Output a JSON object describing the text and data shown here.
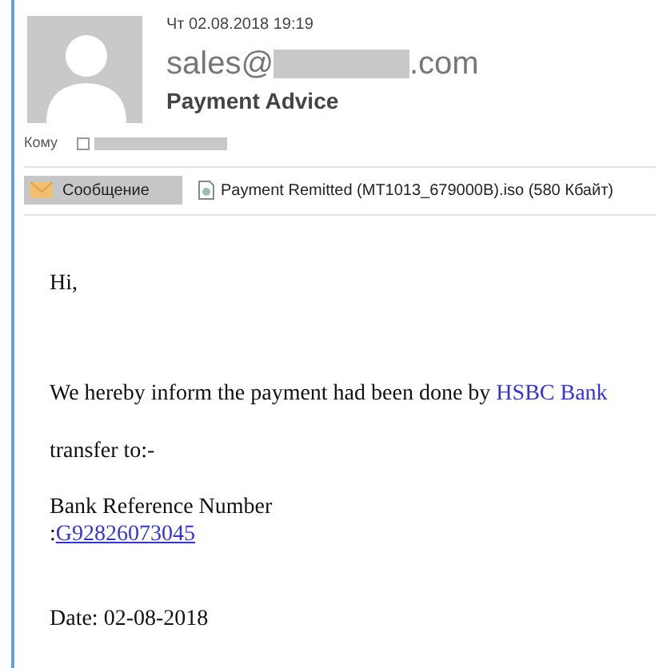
{
  "header": {
    "date": "Чт 02.08.2018 19:19",
    "sender_prefix": "sales@",
    "sender_suffix": ".com",
    "subject": "Payment Advice",
    "to_label": "Кому",
    "to_checked": false
  },
  "tabs": [
    {
      "kind": "message",
      "label": "Сообщение",
      "selected": true
    },
    {
      "kind": "attachment",
      "label": "Payment Remitted (MT1013_679000B).iso (580 Кбайт)",
      "selected": false
    }
  ],
  "body": {
    "greeting": "Hi,",
    "inform_text": "We hereby inform the payment had been done by",
    "inform_link": "HSBC Bank",
    "transfer": "transfer to:-",
    "reference_label": "Bank Reference Number",
    "reference_prefix": ":",
    "reference_link": "G92826073045",
    "date": "Date: 02-08-2018"
  }
}
